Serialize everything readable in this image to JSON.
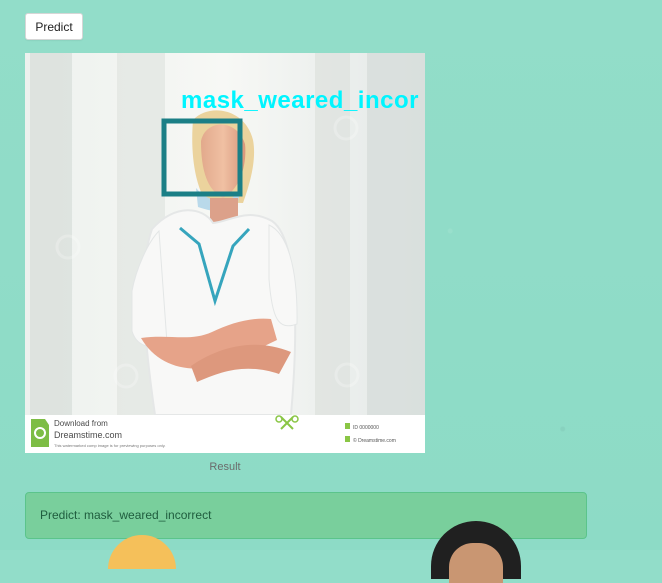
{
  "toolbar": {
    "predict_label": "Predict"
  },
  "image": {
    "detection_label": "mask_weared_incor",
    "caption": "Result",
    "watermark_line_1": "Download from",
    "watermark_line_2": "Dreamstime.com",
    "watermark_small": "This watermarked comp image is for previewing purposes only.",
    "watermark_right_1": "ID 0000000",
    "watermark_right_2": "© Dreamstime.com"
  },
  "result": {
    "message": "Predict: mask_weared_incorrect"
  },
  "colors": {
    "page_background": "#8fdcc8",
    "detection_box": "#1b7f86",
    "detection_text": "#00f5ff",
    "alert_background": "#79cf9c",
    "alert_text": "#1f5d3e"
  },
  "icons": {
    "logo": "dreamstime-logo-icon",
    "scissors": "scissors-icon"
  }
}
